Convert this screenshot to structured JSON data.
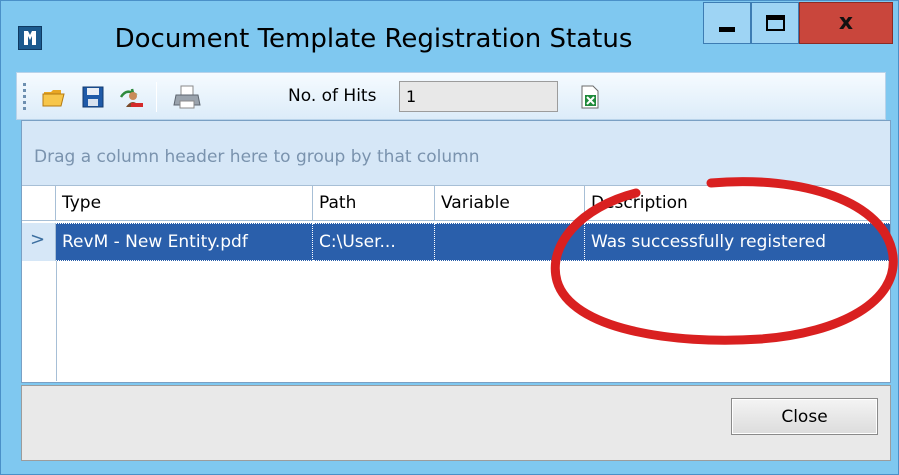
{
  "window": {
    "title": "Document Template Registration Status",
    "controls": {
      "minimize": "minimize",
      "maximize": "maximize",
      "close": "x"
    }
  },
  "toolbar": {
    "icons": [
      "open-folder-icon",
      "save-icon",
      "user-remove-icon",
      "print-icon",
      "excel-export-icon"
    ],
    "hits_label": "No. of Hits",
    "hits_value": "1"
  },
  "grid": {
    "group_hint": "Drag a column header here to group by that column",
    "columns": [
      "Type",
      "Path",
      "Variable",
      "Description"
    ],
    "rows": [
      {
        "indicator": ">",
        "type": "RevM - New Entity.pdf",
        "path": "C:\\User...",
        "variable": "",
        "description": "Was successfully registered"
      }
    ]
  },
  "footer": {
    "close_label": "Close"
  },
  "colors": {
    "window_frame": "#7fc8f0",
    "selection": "#2a5fab",
    "annotation_circle": "#d92020",
    "close_button": "#c9463c"
  }
}
